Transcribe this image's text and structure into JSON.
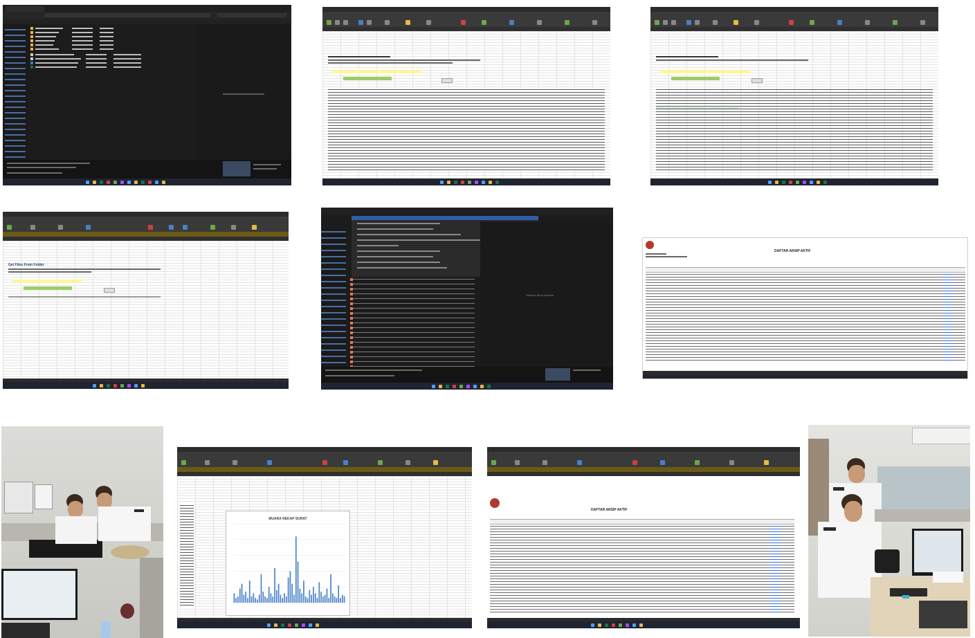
{
  "tiles": {
    "explorer_1": {
      "sidebar_items": [
        "Home",
        "Gallery",
        "Desktop",
        "Downloads",
        "Documents",
        "Pictures",
        "Music",
        "Videos"
      ]
    },
    "excel_1": {
      "heading": "Get Files From Folder"
    },
    "explorer_2": {
      "empty_pane_text": "Select a file to preview."
    },
    "document_1": {
      "title": "DAFTAR ARSIP AKTIF"
    },
    "chart_tile": {
      "title": "MUARA REKAP SURAT"
    },
    "document_2": {
      "title": "DAFTAR ARSIP AKTIF"
    }
  },
  "colors": {
    "dark_ui": "#1e1e1e",
    "excel_ribbon": "#3a3a3a",
    "excel_warning_bar": "#6b5a15",
    "highlight_yellow": "#fff59d",
    "highlight_green": "#9ccc65",
    "chart_bar": "#4a7fc8",
    "taskbar": "#1f2430"
  },
  "chart_data": {
    "type": "bar",
    "title": "MUARA REKAP SURAT",
    "xlabel": "",
    "ylabel": "",
    "ylim": [
      0,
      50
    ],
    "values": [
      6,
      3,
      4,
      9,
      12,
      5,
      7,
      3,
      14,
      4,
      6,
      3,
      2,
      5,
      18,
      7,
      4,
      3,
      10,
      6,
      4,
      22,
      8,
      12,
      5,
      3,
      6,
      4,
      16,
      20,
      12,
      5,
      42,
      26,
      9,
      6,
      14,
      4,
      3,
      8,
      5,
      10,
      6,
      3,
      13,
      7,
      4,
      5,
      9,
      3,
      18,
      6,
      4,
      3,
      11,
      3,
      5,
      4
    ]
  }
}
